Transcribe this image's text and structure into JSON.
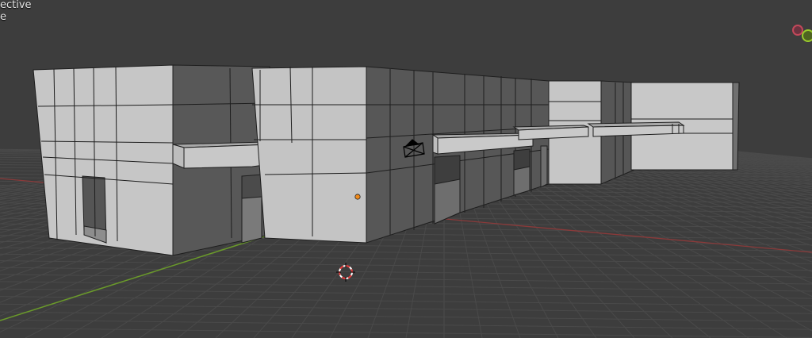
{
  "viewport": {
    "view_name": "ective",
    "view_sub": "e",
    "gizmo": {
      "x_color": "#c2485a",
      "y_color": "#9acb2c"
    }
  },
  "colors": {
    "background": "#3d3d3d",
    "grid": "#464646",
    "face_light": "#c8c8c8",
    "face_mid": "#a9a9a9",
    "face_dark": "#5a5a5a",
    "edge": "#1e1e1e",
    "x_axis": "#8a3a3a",
    "y_axis": "#6a9a2a",
    "origin": "#f08a1a"
  },
  "icons": {
    "camera": "camera-icon",
    "cursor": "3d-cursor-icon",
    "origin": "object-origin-icon"
  }
}
